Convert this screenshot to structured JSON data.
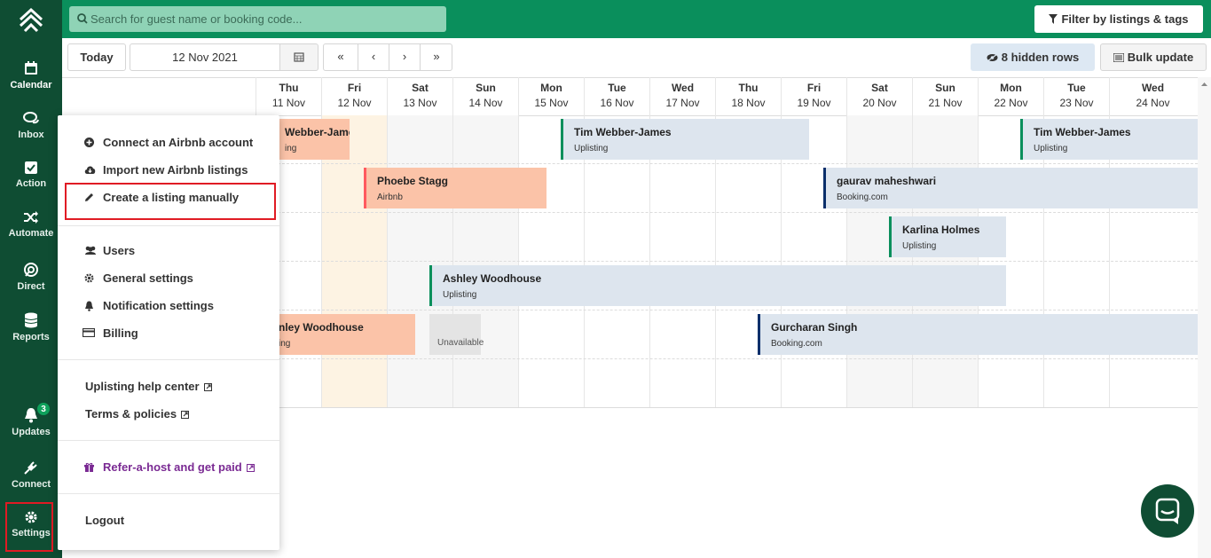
{
  "search": {
    "placeholder": "Search for guest name or booking code..."
  },
  "filter_button": "Filter by listings & tags",
  "toolbar": {
    "today": "Today",
    "date": "12 Nov 2021",
    "first": "«",
    "prev": "‹",
    "next": "›",
    "last": "»",
    "hidden_rows": "8 hidden rows",
    "bulk_update": "Bulk update"
  },
  "sidebar": {
    "items": [
      {
        "label": "Calendar"
      },
      {
        "label": "Inbox"
      },
      {
        "label": "Action"
      },
      {
        "label": "Automate"
      },
      {
        "label": "Direct"
      },
      {
        "label": "Reports"
      },
      {
        "label": "Updates",
        "badge": "3"
      },
      {
        "label": "Connect"
      },
      {
        "label": "Settings"
      }
    ]
  },
  "annotation": "2",
  "days": [
    {
      "dow": "Thu",
      "date": "11 Nov"
    },
    {
      "dow": "Fri",
      "date": "12 Nov"
    },
    {
      "dow": "Sat",
      "date": "13 Nov"
    },
    {
      "dow": "Sun",
      "date": "14 Nov"
    },
    {
      "dow": "Mon",
      "date": "15 Nov"
    },
    {
      "dow": "Tue",
      "date": "16 Nov"
    },
    {
      "dow": "Wed",
      "date": "17 Nov"
    },
    {
      "dow": "Thu",
      "date": "18 Nov"
    },
    {
      "dow": "Fri",
      "date": "19 Nov"
    },
    {
      "dow": "Sat",
      "date": "20 Nov"
    },
    {
      "dow": "Sun",
      "date": "21 Nov"
    },
    {
      "dow": "Mon",
      "date": "22 Nov"
    },
    {
      "dow": "Tue",
      "date": "23 Nov"
    },
    {
      "dow": "Wed",
      "date": "24 Nov"
    }
  ],
  "bookings": [
    {
      "guest": "Webber-James",
      "source": "ing"
    },
    {
      "guest": "Tim Webber-James",
      "source": "Uplisting"
    },
    {
      "guest": "Tim Webber-James",
      "source": "Uplisting"
    },
    {
      "guest": "Phoebe Stagg",
      "source": "Airbnb"
    },
    {
      "guest": "gaurav maheshwari",
      "source": "Booking.com"
    },
    {
      "guest": "Karlina Holmes",
      "source": "Uplisting"
    },
    {
      "guest": "Ashley Woodhouse",
      "source": "Uplisting"
    },
    {
      "guest": "nley Woodhouse",
      "source": "ing"
    },
    {
      "guest": "Gurcharan Singh",
      "source": "Booking.com"
    }
  ],
  "unavailable": "Unavailable",
  "menu": {
    "connect_airbnb": "Connect an Airbnb account",
    "import_airbnb": "Import new Airbnb listings",
    "create_manual": "Create a listing manually",
    "users": "Users",
    "general": "General settings",
    "notification": "Notification settings",
    "billing": "Billing",
    "help": "Uplisting help center",
    "terms": "Terms & policies",
    "refer": "Refer-a-host and get paid",
    "logout": "Logout"
  },
  "colors": {
    "sidebar": "#0f4d33",
    "topbar": "#0a8f5c",
    "uplisting": "#0a8f5c",
    "airbnb": "#ff5a5f",
    "booking": "#0b2f6b",
    "highlight": "#e01b24",
    "purple": "#7a2a93"
  }
}
